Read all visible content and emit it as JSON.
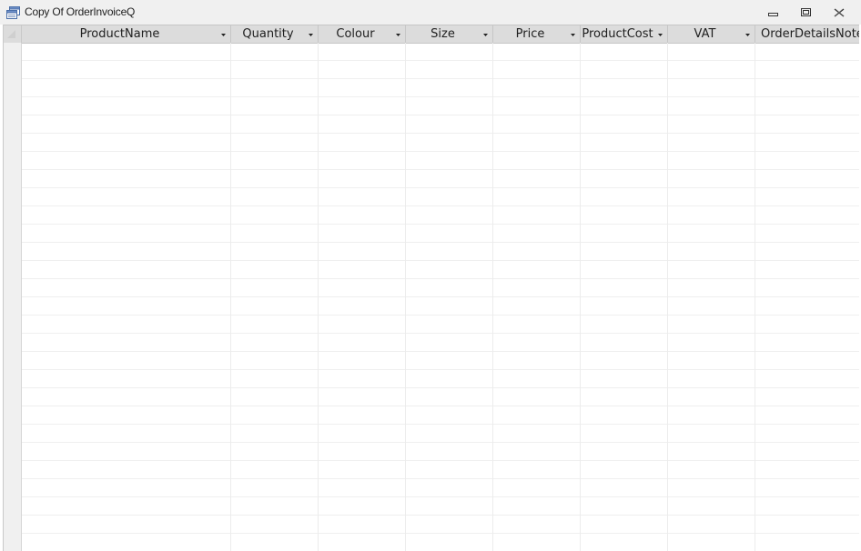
{
  "window": {
    "title": "Copy Of OrderInvoiceQ",
    "icon": "datasheet-icon",
    "controls": [
      "minimize-icon",
      "restore-icon",
      "close-icon"
    ]
  },
  "datasheet": {
    "columns": [
      {
        "label": "ProductName"
      },
      {
        "label": "Quantity"
      },
      {
        "label": "Colour"
      },
      {
        "label": "Size"
      },
      {
        "label": "Price"
      },
      {
        "label": "ProductCost"
      },
      {
        "label": "VAT"
      },
      {
        "label": "OrderDetailsNote"
      }
    ],
    "rows": []
  },
  "colors": {
    "header_bg": "#dcdcdc",
    "gridline": "#efefef",
    "titlebar_bg": "#f0f0f0"
  }
}
